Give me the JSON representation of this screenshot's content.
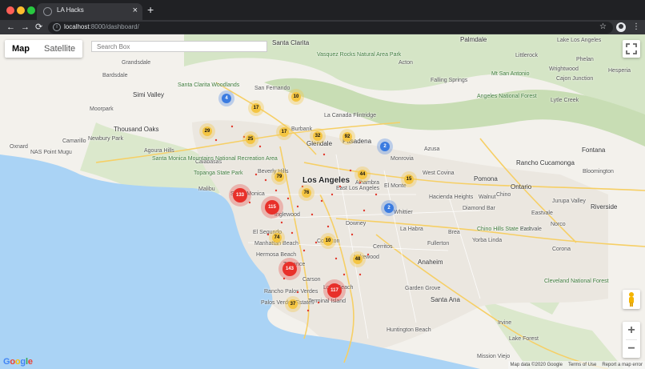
{
  "browser": {
    "tab_title": "LA Hacks",
    "tab_close": "×",
    "new_tab": "+",
    "back": "←",
    "forward": "→",
    "reload": "⟳",
    "url_host": "localhost",
    "url_path": ":8000/dashboard/",
    "info": "i",
    "star": "☆",
    "menu": "⋮"
  },
  "map_controls": {
    "map_label": "Map",
    "satellite_label": "Satellite",
    "search_placeholder": "Search Box",
    "zoom_in": "+",
    "zoom_out": "−"
  },
  "attribution": {
    "google": [
      "G",
      "o",
      "o",
      "g",
      "l",
      "e"
    ],
    "google_colors": [
      "#4285f4",
      "#ea4335",
      "#fbbc05",
      "#4285f4",
      "#34a853",
      "#ea4335"
    ],
    "map_data": "Map data ©2020 Google",
    "terms": "Terms of Use",
    "report": "Report a map error"
  },
  "colors": {
    "water": "#aad3f5",
    "land": "#f3f1ec",
    "urban": "#e9e6e0",
    "mountains": "#cfe3bf",
    "cluster_red": "#e8302a",
    "cluster_yellow": "#f4c542",
    "cluster_blue": "#3a7be0"
  },
  "places": [
    {
      "name": "Los Angeles",
      "size": "big"
    },
    {
      "name": "Simi Valley",
      "size": "med"
    },
    {
      "name": "Thousand Oaks",
      "size": "med"
    },
    {
      "name": "Santa Clarita",
      "size": "med"
    },
    {
      "name": "Palmdale",
      "size": "med"
    },
    {
      "name": "Glendale",
      "size": "med"
    },
    {
      "name": "Pasadena",
      "size": "med"
    },
    {
      "name": "Burbank",
      "size": "sm"
    },
    {
      "name": "Pomona",
      "size": "med"
    },
    {
      "name": "West Covina",
      "size": "sm"
    },
    {
      "name": "Ontario",
      "size": "med"
    },
    {
      "name": "Fontana",
      "size": "med"
    },
    {
      "name": "Rancho Cucamonga",
      "size": "med"
    },
    {
      "name": "Riverside",
      "size": "med"
    },
    {
      "name": "Chino",
      "size": "sm"
    },
    {
      "name": "Jurupa Valley",
      "size": "sm"
    },
    {
      "name": "Anaheim",
      "size": "med"
    },
    {
      "name": "Downey",
      "size": "sm"
    },
    {
      "name": "Inglewood",
      "size": "sm"
    },
    {
      "name": "Torrance",
      "size": "sm"
    },
    {
      "name": "Long Beach",
      "size": "sm"
    },
    {
      "name": "Santa Ana",
      "size": "med"
    },
    {
      "name": "Irvine",
      "size": "sm"
    },
    {
      "name": "Huntington Beach",
      "size": "sm"
    },
    {
      "name": "Garden Grove",
      "size": "sm"
    },
    {
      "name": "Corona",
      "size": "sm"
    },
    {
      "name": "Lake Forest",
      "size": "sm"
    },
    {
      "name": "Mission Viejo",
      "size": "sm"
    },
    {
      "name": "San Fernando",
      "size": "sm"
    },
    {
      "name": "Malibu",
      "size": "sm"
    },
    {
      "name": "Moorpark",
      "size": "sm"
    },
    {
      "name": "Camarillo",
      "size": "sm"
    },
    {
      "name": "Oxnard",
      "size": "sm"
    },
    {
      "name": "Acton",
      "size": "sm"
    },
    {
      "name": "Lake Los Angeles",
      "size": "sm"
    },
    {
      "name": "Littlerock",
      "size": "sm"
    },
    {
      "name": "Mt San Antonio",
      "size": "sm"
    },
    {
      "name": "Wrightwood",
      "size": "sm"
    },
    {
      "name": "Phelan",
      "size": "sm"
    },
    {
      "name": "Hesperia",
      "size": "sm"
    },
    {
      "name": "Bloomington",
      "size": "sm"
    },
    {
      "name": "Norco",
      "size": "sm"
    },
    {
      "name": "Eastvale",
      "size": "sm"
    },
    {
      "name": "Yorba Linda",
      "size": "sm"
    },
    {
      "name": "Fullerton",
      "size": "sm"
    },
    {
      "name": "Brea",
      "size": "sm"
    },
    {
      "name": "Whittier",
      "size": "sm"
    },
    {
      "name": "La Habra",
      "size": "sm"
    },
    {
      "name": "Walnut",
      "size": "sm"
    },
    {
      "name": "Diamond Bar",
      "size": "sm"
    },
    {
      "name": "Hacienda Heights",
      "size": "sm"
    },
    {
      "name": "Azusa",
      "size": "sm"
    },
    {
      "name": "Monrovia",
      "size": "sm"
    },
    {
      "name": "Alhambra",
      "size": "sm"
    },
    {
      "name": "El Monte",
      "size": "sm"
    },
    {
      "name": "Compton",
      "size": "sm"
    },
    {
      "name": "Carson",
      "size": "sm"
    },
    {
      "name": "Lakewood",
      "size": "sm"
    },
    {
      "name": "Cerritos",
      "size": "sm"
    },
    {
      "name": "El Segundo",
      "size": "sm"
    },
    {
      "name": "Manhattan Beach",
      "size": "sm"
    },
    {
      "name": "Hermosa Beach",
      "size": "sm"
    },
    {
      "name": "Rancho Palos Verdes",
      "size": "sm"
    },
    {
      "name": "Palos Verdes Estates",
      "size": "sm"
    },
    {
      "name": "Terminal Island",
      "size": "sm"
    },
    {
      "name": "Santa Monica",
      "size": "sm"
    },
    {
      "name": "Beverly Hills",
      "size": "sm"
    },
    {
      "name": "East Los Angeles",
      "size": "sm"
    },
    {
      "name": "La Canada Flintridge",
      "size": "sm"
    },
    {
      "name": "Agoura Hills",
      "size": "sm"
    },
    {
      "name": "Calabasas",
      "size": "sm"
    },
    {
      "name": "Newbury Park",
      "size": "sm"
    },
    {
      "name": "NAS Point Mugu",
      "size": "sm"
    },
    {
      "name": "Santa Monica Mountains National Recreation Area",
      "size": "sm"
    },
    {
      "name": "Topanga State Park",
      "size": "sm"
    },
    {
      "name": "Chino Hills State Park",
      "size": "sm"
    },
    {
      "name": "Cleveland National Forest",
      "size": "sm"
    },
    {
      "name": "Angeles National Forest",
      "size": "sm"
    },
    {
      "name": "Santa Clarita Woodlands",
      "size": "sm"
    },
    {
      "name": "Vasquez Rocks Natural Area Park",
      "size": "sm"
    },
    {
      "name": "Falling Springs",
      "size": "sm"
    },
    {
      "name": "Cajon Junction",
      "size": "sm"
    },
    {
      "name": "Lytle Creek",
      "size": "sm"
    },
    {
      "name": "Bardsdale",
      "size": "sm"
    },
    {
      "name": "Grandsdale",
      "size": "sm"
    },
    {
      "name": "Eastvale",
      "size": "sm"
    }
  ],
  "clusters": [
    {
      "count": "133",
      "level": "red"
    },
    {
      "count": "115",
      "level": "red"
    },
    {
      "count": "143",
      "level": "red"
    },
    {
      "count": "117",
      "level": "red"
    },
    {
      "count": "4",
      "level": "blue"
    },
    {
      "count": "2",
      "level": "blue"
    },
    {
      "count": "2",
      "level": "blue"
    },
    {
      "count": "10",
      "level": "yellow"
    },
    {
      "count": "17",
      "level": "yellow"
    },
    {
      "count": "17",
      "level": "yellow"
    },
    {
      "count": "29",
      "level": "yellow"
    },
    {
      "count": "25",
      "level": "yellow"
    },
    {
      "count": "32",
      "level": "yellow"
    },
    {
      "count": "92",
      "level": "yellow"
    },
    {
      "count": "44",
      "level": "yellow"
    },
    {
      "count": "15",
      "level": "yellow"
    },
    {
      "count": "79",
      "level": "yellow"
    },
    {
      "count": "76",
      "level": "yellow"
    },
    {
      "count": "74",
      "level": "yellow"
    },
    {
      "count": "10",
      "level": "yellow"
    },
    {
      "count": "48",
      "level": "yellow"
    },
    {
      "count": "37",
      "level": "yellow"
    }
  ]
}
